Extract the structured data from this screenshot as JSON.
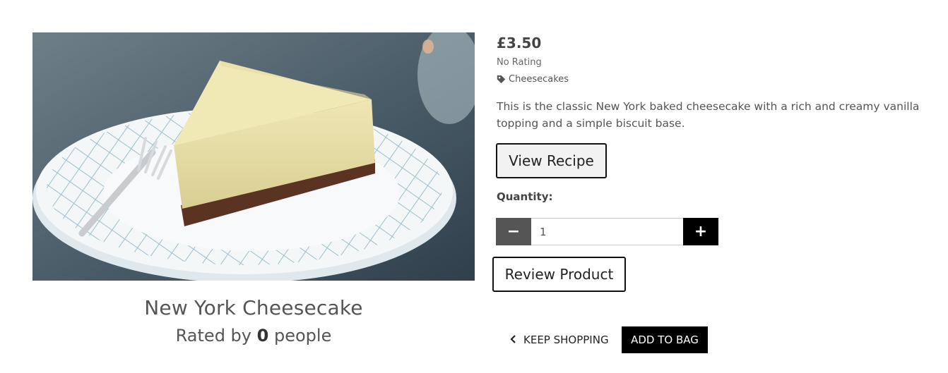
{
  "product": {
    "name": "New York Cheesecake",
    "rated_prefix": "Rated by",
    "rated_count": "0",
    "rated_suffix": "people",
    "image_alt": "Slice of New York cheesecake on a plate with a fork",
    "price": "£3.50",
    "rating_status": "No Rating",
    "category": "Cheesecakes",
    "category_icon": "tag-icon",
    "description": "This is the classic New York baked cheesecake with a rich and creamy vanilla topping and a simple biscuit base."
  },
  "actions": {
    "view_recipe_label": "View Recipe",
    "review_product_label": "Review Product",
    "keep_shopping_label": "Keep Shopping",
    "keep_shopping_icon": "chevron-left-icon",
    "add_to_bag_label": "Add to Bag"
  },
  "quantity": {
    "label": "Quantity:",
    "value": "1",
    "decrement_symbol": "−",
    "increment_symbol": "+"
  },
  "colors": {
    "primary_button": "#000000",
    "decrement_button": "#555555",
    "text": "#555555"
  }
}
